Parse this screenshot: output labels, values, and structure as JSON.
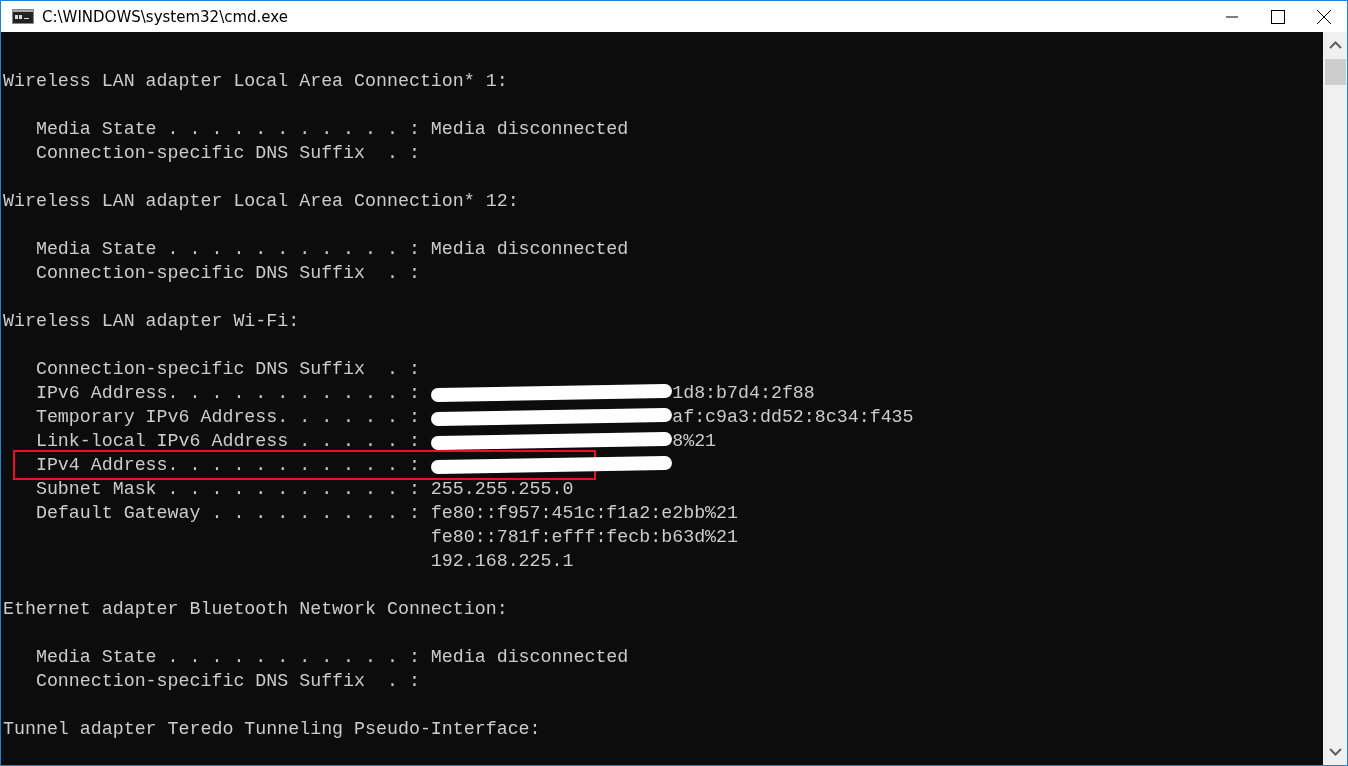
{
  "window": {
    "title": "C:\\WINDOWS\\system32\\cmd.exe"
  },
  "sections": [
    {
      "heading": "Wireless LAN adapter Local Area Connection* 1:",
      "entries": [
        {
          "label": "Media State . . . . . . . . . . . :",
          "values": [
            "Media disconnected"
          ]
        },
        {
          "label": "Connection-specific DNS Suffix  . :"
        }
      ]
    },
    {
      "heading": "Wireless LAN adapter Local Area Connection* 12:",
      "entries": [
        {
          "label": "Media State . . . . . . . . . . . :",
          "values": [
            "Media disconnected"
          ]
        },
        {
          "label": "Connection-specific DNS Suffix  . :"
        }
      ]
    },
    {
      "heading": "Wireless LAN adapter Wi-Fi:",
      "entries": [
        {
          "label": "Connection-specific DNS Suffix  . :"
        },
        {
          "label": "IPv6 Address. . . . . . . . . . . :",
          "values": [
            "1d8:b7d4:2f88"
          ],
          "redacted": true,
          "highlighted": false
        },
        {
          "label": "Temporary IPv6 Address. . . . . . :",
          "values": [
            "af:c9a3:dd52:8c34:f435"
          ],
          "redacted": true,
          "highlighted": false
        },
        {
          "label": "Link-local IPv6 Address . . . . . :",
          "values": [
            "8%21"
          ],
          "redacted": true,
          "highlighted": false
        },
        {
          "label": "IPv4 Address. . . . . . . . . . . :",
          "redacted": true,
          "highlighted": true
        },
        {
          "label": "Subnet Mask . . . . . . . . . . . :",
          "values": [
            "255.255.255.0"
          ]
        },
        {
          "label": "Default Gateway . . . . . . . . . :",
          "values": [
            "fe80::f957:451c:f1a2:e2bb%21",
            "fe80::781f:efff:fecb:b63d%21",
            "192.168.225.1"
          ]
        }
      ]
    },
    {
      "heading": "Ethernet adapter Bluetooth Network Connection:",
      "entries": [
        {
          "label": "Media State . . . . . . . . . . . :",
          "values": [
            "Media disconnected"
          ]
        },
        {
          "label": "Connection-specific DNS Suffix  . :"
        }
      ]
    },
    {
      "heading": "Tunnel adapter Teredo Tunneling Pseudo-Interface:"
    }
  ]
}
